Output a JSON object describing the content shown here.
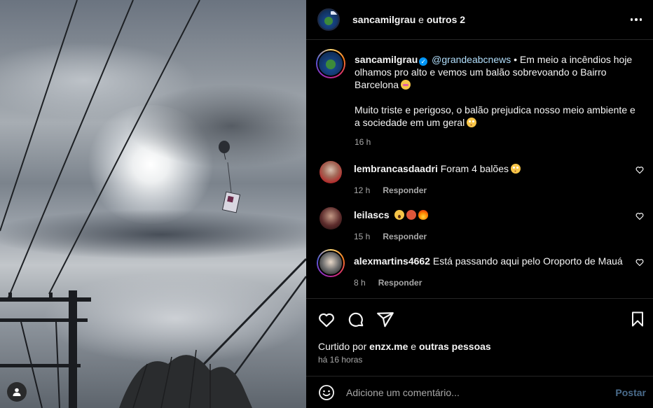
{
  "header": {
    "username": "sancamilgrau",
    "connector": " e ",
    "others": "outros 2"
  },
  "caption": {
    "username": "sancamilgrau",
    "mention": "@grandeabcnews",
    "text_line1": " • Em meio a incêndios hoje olhamos pro alto e vemos um balão sobrevoando o Bairro Barcelona",
    "text_line2": "Muito triste e perigoso, o balão prejudica nosso meio ambiente e a sociedade em um geral",
    "time": "16 h"
  },
  "comments": [
    {
      "username": "lembrancasdaadri",
      "text": "Foram 4 balões",
      "time": "12 h",
      "reply_label": "Responder"
    },
    {
      "username": "leilascs",
      "text": "",
      "time": "15 h",
      "reply_label": "Responder"
    },
    {
      "username": "alexmartins4662",
      "text": "Está passando aqui pelo Oroporto de Mauá",
      "time": "8 h",
      "reply_label": "Responder"
    }
  ],
  "likes": {
    "prefix": "Curtido por ",
    "user": "enzx.me",
    "connector": " e ",
    "others": "outras pessoas"
  },
  "post_time": "há 16 horas",
  "comment_box": {
    "placeholder": "Adicione um comentário...",
    "post_label": "Postar"
  },
  "colors": {
    "background": "#000000",
    "text": "#f5f5f5",
    "secondary": "#a8a8a8",
    "verified": "#0095f6",
    "post_disabled": "#4a6c8c"
  },
  "icons": [
    "more-icon",
    "verified-icon",
    "heart-icon",
    "comment-icon",
    "share-icon",
    "bookmark-icon",
    "emoji-icon",
    "user-icon"
  ]
}
